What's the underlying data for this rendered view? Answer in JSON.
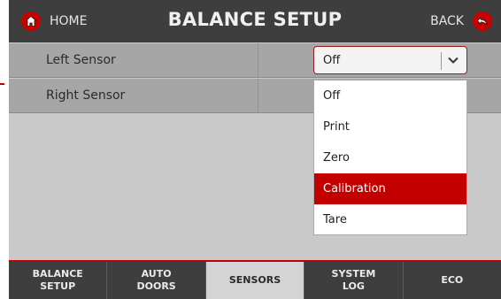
{
  "header": {
    "home_label": "HOME",
    "title": "BALANCE SETUP",
    "back_label": "BACK",
    "accent": "#c90000"
  },
  "rows": [
    {
      "label": "Left Sensor"
    },
    {
      "label": "Right Sensor"
    }
  ],
  "select": {
    "value": "Off"
  },
  "dropdown": {
    "options": [
      "Off",
      "Print",
      "Zero",
      "Calibration",
      "Tare"
    ],
    "highlighted": "Calibration"
  },
  "tabs": [
    {
      "line1": "BALANCE",
      "line2": "SETUP"
    },
    {
      "line1": "AUTO",
      "line2": "DOORS"
    },
    {
      "line1": "SENSORS",
      "line2": ""
    },
    {
      "line1": "SYSTEM",
      "line2": "LOG"
    },
    {
      "line1": "ECO",
      "line2": ""
    }
  ],
  "active_tab": "SENSORS",
  "icons": {
    "home": "home-icon",
    "back": "back-arrow-icon",
    "chevron": "chevron-down-icon"
  }
}
